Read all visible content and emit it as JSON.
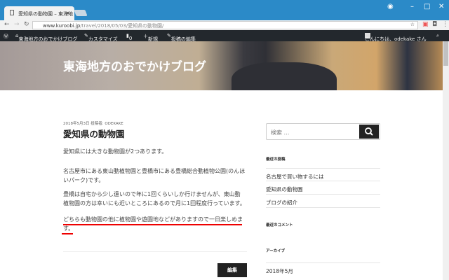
{
  "browser": {
    "tab_title": "愛知県の動物園 – 東海地",
    "tab_close": "×",
    "url_host": "www.kuroobi.jp",
    "url_path": "/travel/2018/05/03/愛知県の動物園/"
  },
  "adminbar": {
    "site": "東海地方のおでかけブログ",
    "customize": "カスタマイズ",
    "comments": "0",
    "new": "新規",
    "edit_post": "投稿の編集",
    "greeting": "こんにちは、odekake さん"
  },
  "header": {
    "site_title": "東海地方のおでかけブログ"
  },
  "post": {
    "meta": "2018年5月3日 投稿者: ODEKAKE",
    "title": "愛知県の動物園",
    "paragraphs": [
      "愛知県には大きな動物園が2つあります。",
      "名古屋市にある東山動植物園と豊橋市にある豊橋総合動植物公園(のんほいパーク)です。",
      "豊橋は自宅から少し遠いので年に1回くらいしか行けませんが、東山動植物園の方は幸いにも近いところにあるので月に1回程度行っています。",
      "どちらも動物園の他に植物園や遊園地などがありますので一日楽しめます。"
    ],
    "edit_label": "編集"
  },
  "sidebar": {
    "search_placeholder": "検索 …",
    "recent_posts_heading": "最近の投稿",
    "recent_posts": [
      "名古屋で買い物するには",
      "愛知県の動物園",
      "ブログの紹介"
    ],
    "recent_comments_heading": "最近のコメント",
    "archives_heading": "アーカイブ",
    "archives": [
      "2018年5月"
    ]
  },
  "colors": {
    "titlebar": "#2b8ac8",
    "adminbar": "#23282d",
    "highlight_underline": "#e00000"
  }
}
